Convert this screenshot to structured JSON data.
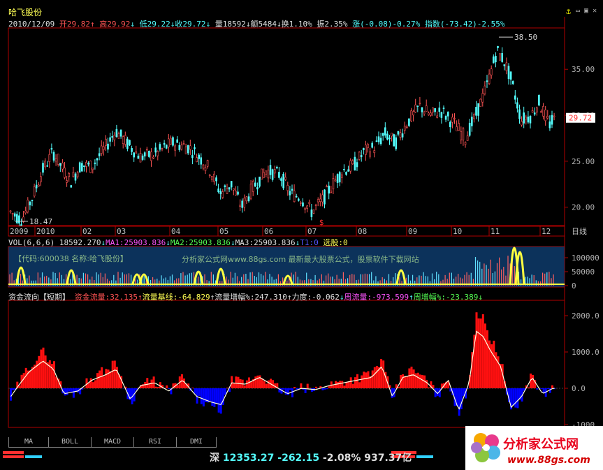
{
  "window": {
    "title": "哈飞股份",
    "tool_icon": "⚓",
    "window_buttons": "▭ ▣ ✕"
  },
  "quote": {
    "date": "2010/12/09",
    "open_label": "开",
    "open": "29.82",
    "high_label": "高",
    "high": "29.92",
    "low_label": "低",
    "low": "29.22",
    "close_label": "收",
    "close": "29.72",
    "volume_label": "量",
    "volume": "18592",
    "amount_label": "额",
    "amount": "5484",
    "turnover_label": "换",
    "turnover": "1.10%",
    "amplitude_label": "振",
    "amplitude": "2.35%",
    "change_label": "涨",
    "change": "(-0.08)-0.27%",
    "index_label": "指数",
    "index_change": "(-73.42)-2.55%"
  },
  "price_chart": {
    "y_ticks": [
      "35.00",
      "30.00",
      "25.00",
      "20.00"
    ],
    "last_price_tag": "29.72",
    "high_marker": "38.50",
    "low_marker": "18.47",
    "signal_marker": "$",
    "x_labels": [
      "2009",
      "2010",
      "02",
      "03",
      "04",
      "05",
      "06",
      "07",
      "08",
      "09",
      "10",
      "11",
      "12"
    ],
    "period_label": "日线"
  },
  "volume_header": {
    "name": "VOL(6,6,6)",
    "value": "18592.270",
    "ma1_label": "MA1:",
    "ma1": "25903.836",
    "ma2_label": "MA2:",
    "ma2": "25903.836",
    "ma3_label": "MA3:",
    "ma3": "25903.836",
    "extra": "T1:0",
    "pick_label": "选股:",
    "pick": "0"
  },
  "volume_panel": {
    "stock_banner": "【代码:600038 名称:哈飞股份】",
    "promo": "分析家公式网www.88gs.com 最新最大股票公式，股票软件下载网站",
    "y_ticks": [
      "100000",
      "50000",
      "0"
    ]
  },
  "flow_header": {
    "name": "资金流向【短期】",
    "flow_label": "资金流量:",
    "flow": "32.135",
    "base_label": "流量基线:",
    "base": "-64.829",
    "growth_label": "流量增幅%:",
    "growth": "247.310",
    "force_label": "力度:",
    "force": "-0.062",
    "week_label": "周流量:",
    "week": "-973.599",
    "week_growth_label": "周增幅%:",
    "week_growth": "-23.389"
  },
  "flow_panel": {
    "y_ticks": [
      "2000.0",
      "1000.0",
      "0.0",
      "-1000"
    ]
  },
  "tabs": [
    "MA",
    "BOLL",
    "MACD",
    "RSI",
    "DMI"
  ],
  "status": {
    "market": "深",
    "index": "12353.27",
    "change": "-262.15",
    "percent": "-2.08%",
    "turnover": "937.37亿"
  },
  "logo": {
    "title": "分析家公式网",
    "url": "www.88gs.com"
  },
  "colors": {
    "up": "#ff5454",
    "down": "#54ffff",
    "ma": "#ffff54",
    "axis": "#b00000",
    "flow_down": "#0000ff"
  }
}
